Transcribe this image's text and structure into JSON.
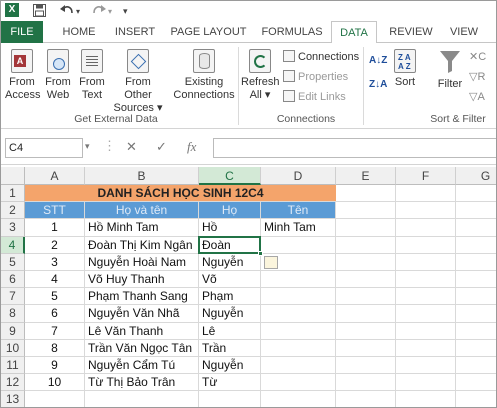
{
  "quick_access": {
    "excel_icon": "X",
    "save_icon": "save-icon",
    "undo_icon": "undo-icon",
    "redo_icon": "redo-icon"
  },
  "tabs": [
    "FILE",
    "HOME",
    "INSERT",
    "PAGE LAYOUT",
    "FORMULAS",
    "DATA",
    "REVIEW",
    "VIEW"
  ],
  "active_tab": "DATA",
  "ribbon": {
    "get_external": {
      "buttons": [
        {
          "line1": "From",
          "line2": "Access"
        },
        {
          "line1": "From",
          "line2": "Web"
        },
        {
          "line1": "From",
          "line2": "Text"
        },
        {
          "line1": "From Other",
          "line2": "Sources ▾"
        },
        {
          "line1": "Existing",
          "line2": "Connections"
        }
      ],
      "label": "Get External Data"
    },
    "connections": {
      "refresh": {
        "line1": "Refresh",
        "line2": "All ▾"
      },
      "items": [
        "Connections",
        "Properties",
        "Edit Links"
      ],
      "label": "Connections"
    },
    "sort_filter": {
      "sort": "Sort",
      "filter": "Filter",
      "az": "A↓Z",
      "za": "Z↓A",
      "label": "Sort & Filter"
    }
  },
  "formula_bar": {
    "name_box": "C4",
    "cancel": "✕",
    "enter": "✓",
    "fx": "fx",
    "value": ""
  },
  "columns": [
    "A",
    "B",
    "C",
    "D",
    "E",
    "F",
    "G"
  ],
  "rows": [
    "1",
    "2",
    "3",
    "4",
    "5",
    "6",
    "7",
    "8",
    "9",
    "10",
    "11",
    "12",
    "13"
  ],
  "sheet": {
    "title": "DANH SÁCH HỌC SINH 12C4",
    "headers": [
      "STT",
      "Họ và tên",
      "Họ",
      "Tên"
    ],
    "records": [
      {
        "stt": "1",
        "name": "Hồ Minh Tam",
        "ho": "Hồ",
        "ten": "Minh Tam"
      },
      {
        "stt": "2",
        "name": "Đoàn Thị Kim Ngân",
        "ho": "Đoàn",
        "ten": ""
      },
      {
        "stt": "3",
        "name": "Nguyễn Hoài Nam",
        "ho": "Nguyễn",
        "ten": ""
      },
      {
        "stt": "4",
        "name": "Võ Huy Thanh",
        "ho": "Võ",
        "ten": ""
      },
      {
        "stt": "5",
        "name": "Phạm Thanh Sang",
        "ho": "Phạm",
        "ten": ""
      },
      {
        "stt": "6",
        "name": "Nguyễn Văn Nhã",
        "ho": "Nguyễn",
        "ten": ""
      },
      {
        "stt": "7",
        "name": "Lê Văn Thanh",
        "ho": "Lê",
        "ten": ""
      },
      {
        "stt": "8",
        "name": "Trần Văn Ngọc Tân",
        "ho": "Trần",
        "ten": ""
      },
      {
        "stt": "9",
        "name": "Nguyễn Cẩm Tú",
        "ho": "Nguyễn",
        "ten": ""
      },
      {
        "stt": "10",
        "name": "Từ Thị Bảo Trân",
        "ho": "Từ",
        "ten": ""
      }
    ]
  },
  "colors": {
    "accent": "#217346",
    "header_blue": "#5b9bd5",
    "title_orange": "#f4a46b"
  }
}
